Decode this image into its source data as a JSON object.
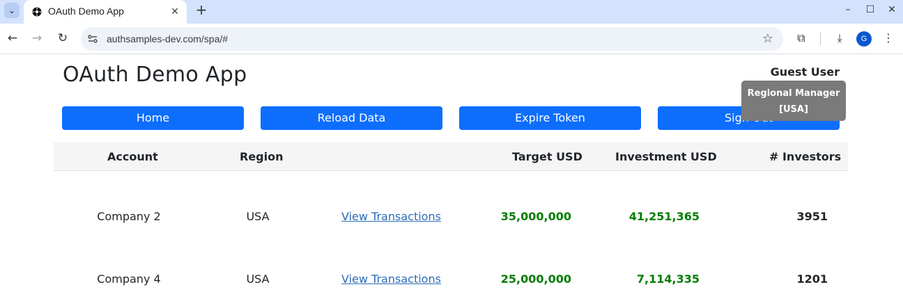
{
  "browser": {
    "tab_title": "OAuth Demo App",
    "url": "authsamples-dev.com/spa/#",
    "profile_initial": "G"
  },
  "app": {
    "title": "OAuth Demo App",
    "user_name": "Guest User",
    "tooltip": {
      "line1": "Regional Manager",
      "line2": "[USA]"
    },
    "buttons": {
      "home": "Home",
      "reload": "Reload Data",
      "expire": "Expire Token",
      "signout": "Sign Out"
    }
  },
  "table": {
    "headers": {
      "account": "Account",
      "region": "Region",
      "target": "Target USD",
      "investment": "Investment USD",
      "investors": "# Investors"
    },
    "rows": [
      {
        "account": "Company 2",
        "region": "USA",
        "link": "View Transactions",
        "target": "35,000,000",
        "investment": "41,251,365",
        "investors": "3951"
      },
      {
        "account": "Company 4",
        "region": "USA",
        "link": "View Transactions",
        "target": "25,000,000",
        "investment": "7,114,335",
        "investors": "1201"
      }
    ]
  },
  "colors": {
    "primary_button": "#0d6efd",
    "money_green": "#007d00",
    "tooltip_bg": "#7a7a7a"
  }
}
